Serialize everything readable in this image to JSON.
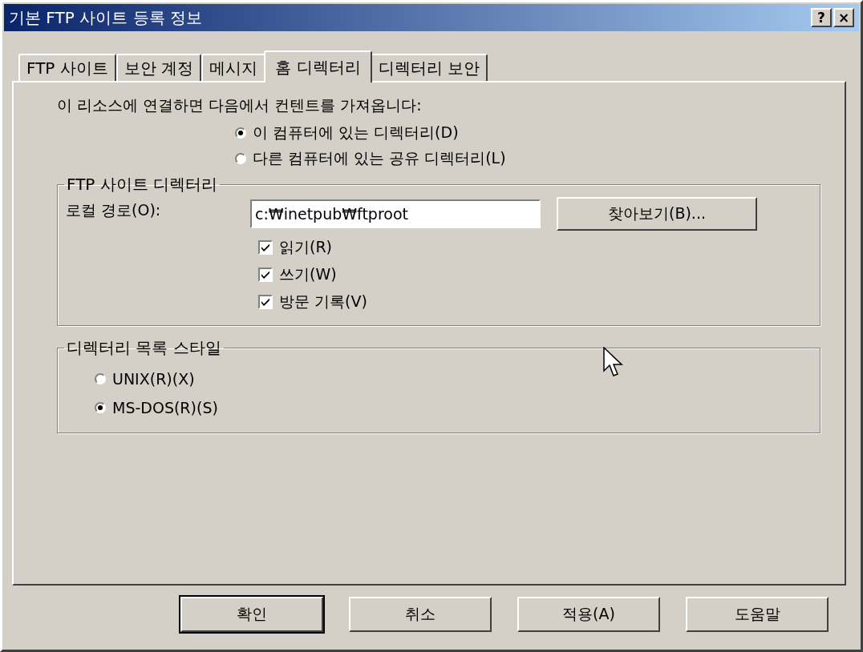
{
  "window": {
    "title": "기본 FTP 사이트 등록 정보",
    "help_button": "?",
    "close_button": "×"
  },
  "tabs": [
    {
      "label": "FTP 사이트",
      "selected": false
    },
    {
      "label": "보안 계정",
      "selected": false
    },
    {
      "label": "메시지",
      "selected": false
    },
    {
      "label": "홈 디렉터리",
      "selected": true
    },
    {
      "label": "디렉터리 보안",
      "selected": false
    }
  ],
  "content_source": {
    "label": "이 리소스에 연결하면 다음에서 컨텐트를 가져옵니다:",
    "options": [
      {
        "label": "이 컴퓨터에 있는 디렉터리(D)",
        "selected": true
      },
      {
        "label": "다른 컴퓨터에 있는 공유 디렉터리(L)",
        "selected": false
      }
    ]
  },
  "ftp_site_directory": {
    "title": "FTP 사이트 디렉터리",
    "local_path_label": "로컬 경로(O):",
    "local_path_value": "c:₩inetpub₩ftproot",
    "browse_button": "찾아보기(B)...",
    "permissions": [
      {
        "label": "읽기(R)",
        "checked": true
      },
      {
        "label": "쓰기(W)",
        "checked": true
      },
      {
        "label": "방문 기록(V)",
        "checked": true
      }
    ]
  },
  "listing_style": {
    "title": "디렉터리 목록 스타일",
    "options": [
      {
        "label": "UNIX(R)(X)",
        "selected": false
      },
      {
        "label": "MS-DOS(R)(S)",
        "selected": true
      }
    ]
  },
  "buttons": [
    {
      "label": "확인",
      "default": true
    },
    {
      "label": "취소",
      "default": false
    },
    {
      "label": "적용(A)",
      "default": false
    },
    {
      "label": "도움말",
      "default": false
    }
  ]
}
